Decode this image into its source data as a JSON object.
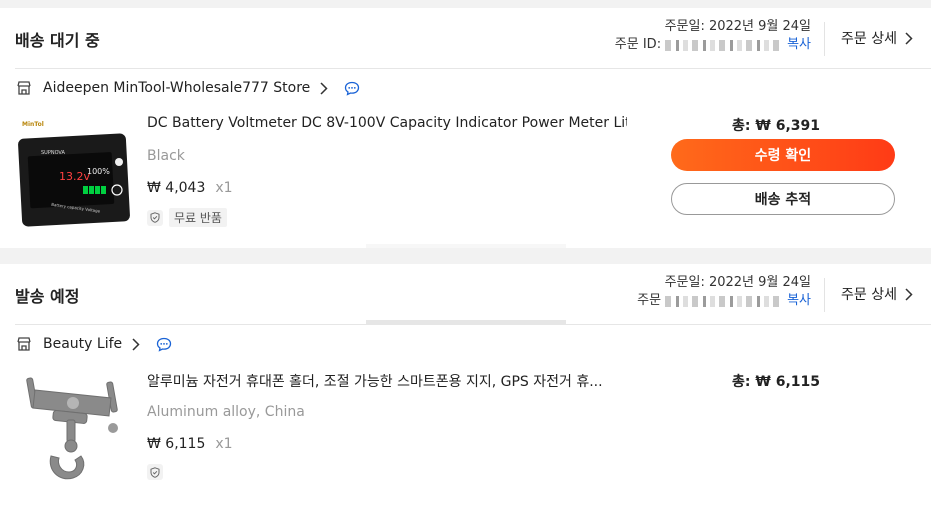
{
  "orders": [
    {
      "status": "배송 대기 중",
      "order_date": "주문일: 2022년 9월 24일",
      "order_id_label": "주문 ID:",
      "copy_label": "복사",
      "detail_label": "주문 상세",
      "store_name": "Aideepen MinTool-Wholesale777 Store",
      "product_title": "DC Battery Voltmeter DC 8V-100V Capacity Indicator Power Meter Lithi...",
      "variant": "Black",
      "price": "₩ 4,043",
      "qty": "x1",
      "badge": "무료 반품",
      "total": "총: ₩ 6,391",
      "primary_button": "수령 확인",
      "secondary_button": "배송 추적"
    },
    {
      "status": "발송 예정",
      "order_date": "주문일: 2022년 9월 24일",
      "order_id_label": "주문",
      "copy_label": "복사",
      "detail_label": "주문 상세",
      "store_name": "Beauty Life",
      "product_title": "알루미늄 자전거 휴대폰 홀더, 조절 가능한 스마트폰용 지지, GPS 자전거 휴...",
      "variant": "Aluminum alloy, China",
      "price": "₩ 6,115",
      "qty": "x1",
      "total": "총: ₩ 6,115"
    }
  ],
  "product_image_text": {
    "display_voltage": "13.2v",
    "display_percent": "100%",
    "panel_label": "Battery capacity Voltage",
    "brand": "SUPNOVA",
    "logo": "MinTol"
  },
  "colors": {
    "accent": "#ff4b17",
    "link": "#1a63d6",
    "muted": "#999999"
  },
  "icons": [
    "store-icon",
    "chevron-right-icon",
    "chat-icon",
    "shield-icon"
  ]
}
